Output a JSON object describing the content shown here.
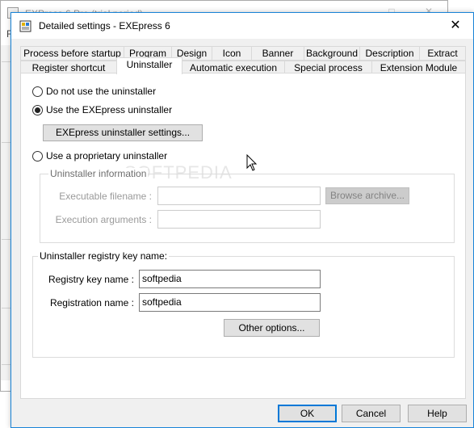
{
  "background_window": {
    "title": "EXPress 6 Pro (trial period)",
    "menu_fragment": "Fi",
    "buttons": [
      "—",
      "□",
      "✕"
    ]
  },
  "dialog": {
    "title": "Detailed settings - EXEpress 6",
    "close_glyph": "✕",
    "tabs_row1": [
      "Process before startup",
      "Program",
      "Design",
      "Icon",
      "Banner",
      "Background",
      "Description",
      "Extract"
    ],
    "tabs_row2": [
      "Register shortcut",
      "Uninstaller",
      "Automatic execution",
      "Special process",
      "Extension Module"
    ],
    "active_tab": "Uninstaller"
  },
  "uninstaller": {
    "radio_none": "Do not use the uninstaller",
    "radio_exepress": "Use the EXEpress uninstaller",
    "exepress_settings_button": "EXEpress uninstaller settings...",
    "radio_proprietary": "Use a proprietary uninstaller",
    "selected": "Use the EXEpress uninstaller",
    "info_group": {
      "title": "Uninstaller information",
      "executable_label": "Executable filename :",
      "executable_value": "",
      "browse_button": "Browse archive...",
      "arguments_label": "Execution arguments :",
      "arguments_value": ""
    },
    "registry_group": {
      "title": "Uninstaller registry key name:",
      "key_label": "Registry key name :",
      "key_value": "softpedia",
      "registration_label": "Registration name :",
      "registration_value": "softpedia",
      "other_options_button": "Other options..."
    }
  },
  "watermark": "SOFTPEDIA",
  "footer": {
    "ok": "OK",
    "cancel": "Cancel",
    "help": "Help"
  },
  "colors": {
    "accent": "#0078d7",
    "dialog_border": "#1883d7",
    "dialog_bg": "#f0f0f0"
  }
}
